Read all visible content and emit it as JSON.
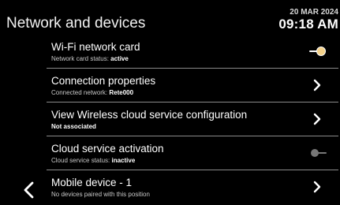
{
  "header": {
    "title": "Network and devices"
  },
  "clock": {
    "date": "20 MAR 2024",
    "time": "09:18 AM"
  },
  "rows": [
    {
      "title": "Wi-Fi network card",
      "sub_label": "Network card status: ",
      "sub_value": "active",
      "control": "toggle",
      "toggle_state": "on"
    },
    {
      "title": "Connection properties",
      "sub_label": "Connected network: ",
      "sub_value": "Rete000",
      "control": "chevron"
    },
    {
      "title": "View Wireless cloud service configuration",
      "sub_label": "",
      "sub_value": "Not associated",
      "control": "chevron"
    },
    {
      "title": "Cloud service activation",
      "sub_label": "Cloud service status: ",
      "sub_value": "inactive",
      "control": "toggle",
      "toggle_state": "off"
    },
    {
      "title": "Mobile device - 1",
      "sub_label": "No devices paired with this position",
      "sub_value": "",
      "control": "chevron"
    }
  ],
  "icons": {
    "back": "chevron-left-icon",
    "row_chevron": "chevron-right-icon",
    "toggle_on": "toggle-on-icon",
    "toggle_off": "toggle-off-icon"
  },
  "colors": {
    "background": "#000000",
    "text": "#ffffff",
    "toggle_on_knob": "#f5d28a",
    "toggle_off_knob": "#777777",
    "divider": "#8a8a8a"
  }
}
